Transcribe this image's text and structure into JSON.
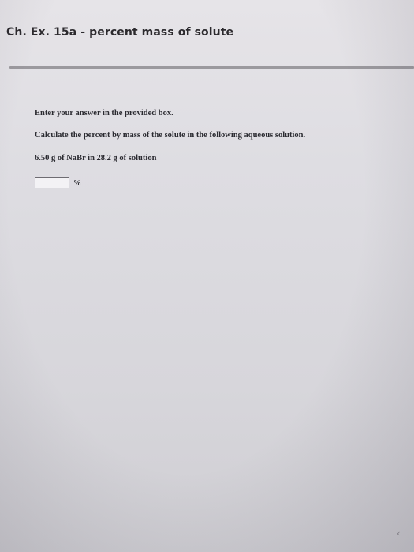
{
  "header": {
    "title": "Ch. Ex. 15a - percent mass of solute"
  },
  "question": {
    "instruction": "Enter your answer in the provided box.",
    "prompt": "Calculate the percent by mass of the solute in the following aqueous solution.",
    "given": "6.50 g of NaBr in 28.2 g of solution",
    "answer_value": "",
    "answer_unit": "%"
  },
  "corner": {
    "glyph": "‹",
    "icon": "chevron-left-icon"
  }
}
